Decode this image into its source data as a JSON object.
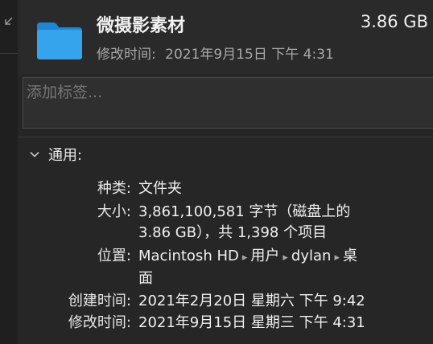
{
  "header": {
    "name": "微摄影素材",
    "size": "3.86 GB",
    "modified_label": "修改时间:",
    "modified_value": "2021年9月15日 下午 4:31"
  },
  "tags": {
    "placeholder": "添加标签..."
  },
  "general": {
    "title": "通用:",
    "kind_label": "种类:",
    "kind_value": "文件夹",
    "size_label": "大小:",
    "size_line1": "3,861,100,581 字节（磁盘上的",
    "size_line2": "3.86 GB），共 1,398 个项目",
    "where_label": "位置:",
    "where_path": [
      "Macintosh HD",
      "用户",
      "dylan",
      "桌"
    ],
    "where_line2": "面",
    "path_separator": "▸",
    "created_label": "创建时间:",
    "created_value": "2021年2月20日 星期六 下午 9:42",
    "modified_label": "修改时间:",
    "modified_value": "2021年9月15日 星期三 下午 4:31"
  },
  "icons": {
    "folder": "folder-icon",
    "chevron": "chevron-down-icon",
    "resize": "resize-icon"
  },
  "colors": {
    "folder_blue": "#2f9be6",
    "background": "#262626"
  }
}
